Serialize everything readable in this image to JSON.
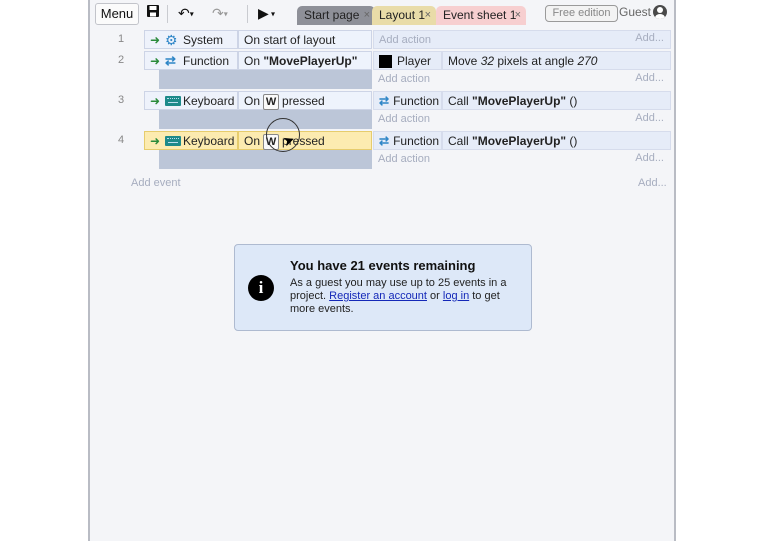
{
  "toolbar": {
    "menu_label": "Menu",
    "tabs": [
      {
        "label": "Start page",
        "close": "×",
        "color": "#8e9098"
      },
      {
        "label": "Layout 1",
        "close": "×",
        "color": "#e9dca8"
      },
      {
        "label": "Event sheet 1",
        "close": "×",
        "color": "#f7cfd0"
      }
    ],
    "free_edition": "Free edition",
    "guest_label": "Guest"
  },
  "events": [
    {
      "number": "1",
      "object": "System",
      "object_icon": "gear-icon",
      "condition": "On start of layout",
      "actions": [
        {
          "text": "Add action"
        }
      ],
      "add_right": "Add..."
    },
    {
      "number": "2",
      "object": "Function",
      "object_icon": "function-icon",
      "condition_prefix": "On ",
      "condition_bold": "\"MovePlayerUp\"",
      "action_object": "Player",
      "action_text_pre": "Move ",
      "action_italic1": "32",
      "action_text_mid": " pixels at angle ",
      "action_italic2": "270",
      "add_action": "Add action",
      "add_right": "Add..."
    },
    {
      "number": "3",
      "object": "Keyboard",
      "object_icon": "keyboard-icon",
      "condition_prefix": "On",
      "key": "W",
      "condition_suffix": "pressed",
      "action_object": "Function",
      "action_pre": "Call ",
      "action_bold": "\"MovePlayerUp\"",
      "action_post": " ()",
      "add_action": "Add action",
      "add_right": "Add..."
    },
    {
      "number": "4",
      "object": "Keyboard",
      "object_icon": "keyboard-icon",
      "condition_prefix": "On",
      "key": "W",
      "condition_suffix": "pressed",
      "action_object": "Function",
      "action_pre": "Call ",
      "action_bold": "\"MovePlayerUp\"",
      "action_post": " ()",
      "add_action": "Add action",
      "add_right": "Add..."
    }
  ],
  "add_event": "Add event",
  "add_event_right": "Add...",
  "notice": {
    "title": "You have 21 events remaining",
    "body_pre": "As a guest you may use up to 25 events in a project. ",
    "link_register": "Register an account",
    "body_mid": " or ",
    "link_login": "log in",
    "body_post": " to get more events."
  }
}
